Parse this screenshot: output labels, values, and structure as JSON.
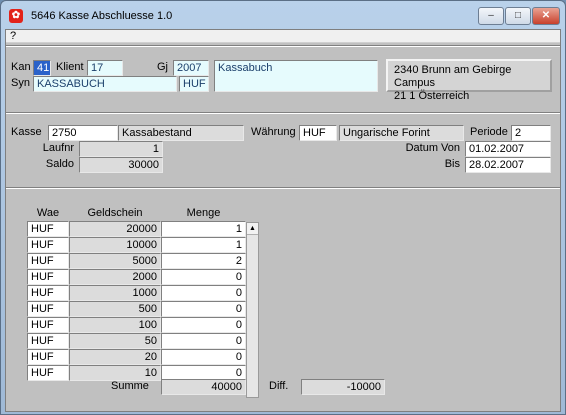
{
  "window": {
    "title": "5646 Kasse Abschluesse 1.0",
    "icon": "oracle-forms-app-icon",
    "min_glyph": "–",
    "max_glyph": "□",
    "close_glyph": "✕"
  },
  "menu": {
    "help": "?"
  },
  "header": {
    "kan_label": "Kan",
    "kan_value": "41",
    "klient_label": "Klient",
    "klient_value": "17",
    "gj_label": "Gj",
    "gj_value": "2007",
    "kassabuch_value": "Kassabuch",
    "syn_label": "Syn",
    "syn_value": "KASSABUCH",
    "currency_value": "HUF",
    "address_line1": "2340 Brunn am Gebirge Campus",
    "address_line2": "21 1 Österreich"
  },
  "detail": {
    "kasse_label": "Kasse",
    "kasse_code": "2750",
    "kasse_name": "Kassabestand",
    "waehrung_label": "Währung",
    "waehrung_code": "HUF",
    "waehrung_name": "Ungarische Forint",
    "periode_label": "Periode",
    "periode_value": "2",
    "laufnr_label": "Laufnr",
    "laufnr_value": "1",
    "datum_von_label": "Datum Von",
    "datum_von_value": "01.02.2007",
    "saldo_label": "Saldo",
    "saldo_value": "30000",
    "bis_label": "Bis",
    "bis_value": "28.02.2007"
  },
  "grid": {
    "col_wae": "Wae",
    "col_geldschein": "Geldschein",
    "col_menge": "Menge",
    "rows": [
      {
        "wae": "HUF",
        "geldschein": "20000",
        "menge": "1"
      },
      {
        "wae": "HUF",
        "geldschein": "10000",
        "menge": "1"
      },
      {
        "wae": "HUF",
        "geldschein": "5000",
        "menge": "2"
      },
      {
        "wae": "HUF",
        "geldschein": "2000",
        "menge": "0"
      },
      {
        "wae": "HUF",
        "geldschein": "1000",
        "menge": "0"
      },
      {
        "wae": "HUF",
        "geldschein": "500",
        "menge": "0"
      },
      {
        "wae": "HUF",
        "geldschein": "100",
        "menge": "0"
      },
      {
        "wae": "HUF",
        "geldschein": "50",
        "menge": "0"
      },
      {
        "wae": "HUF",
        "geldschein": "20",
        "menge": "0"
      },
      {
        "wae": "HUF",
        "geldschein": "10",
        "menge": "0"
      }
    ],
    "scroll_up_glyph": "▲"
  },
  "footer": {
    "summe_label": "Summe",
    "summe_value": "40000",
    "diff_label": "Diff.",
    "diff_value": "-10000"
  }
}
